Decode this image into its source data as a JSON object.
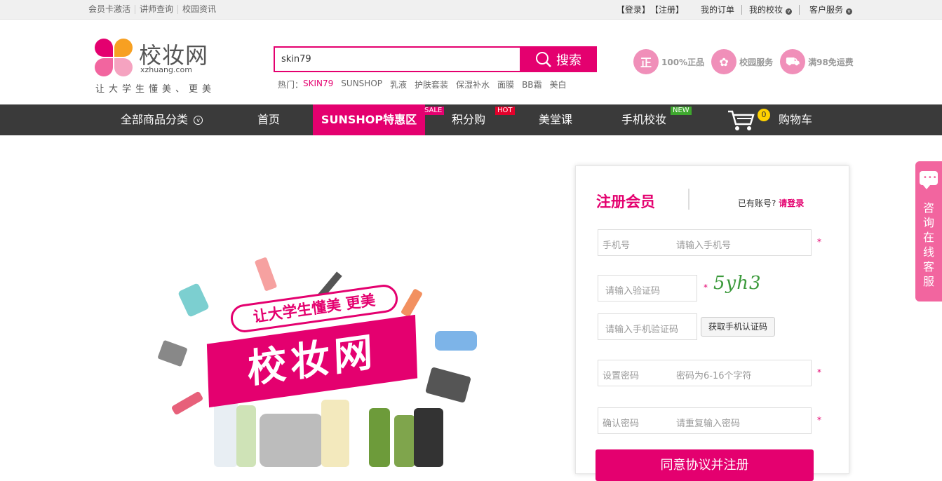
{
  "topbar": {
    "left": [
      "会员卡激活",
      "讲师查询",
      "校园资讯"
    ],
    "login": "【登录】",
    "register": "【注册】",
    "orders": "我的订单",
    "my_campus": "我的校妆",
    "customer_service": "客户服务"
  },
  "logo": {
    "brand": "校妆网",
    "domain": "xzhuang.com",
    "slogan": "让大学生懂美、更美"
  },
  "search": {
    "value": "skin79",
    "button": "搜索",
    "hot_label": "热门：",
    "hot_terms": [
      "SKIN79",
      "SUNSHOP",
      "乳液",
      "护肤套装",
      "保湿补水",
      "面膜",
      "BB霜",
      "美白"
    ]
  },
  "promos": [
    {
      "icon_char": "正",
      "label": "100%正品"
    },
    {
      "icon_char": "✿",
      "label": "校园服务"
    },
    {
      "icon_char": "⛟",
      "label": "满98免运费"
    }
  ],
  "nav": {
    "categories": "全部商品分类",
    "home": "首页",
    "sunshop": "SUNSHOP特惠区",
    "sale": "SALE",
    "points": "积分购",
    "hot": "HOT",
    "beauty_class": "美堂课",
    "mobile": "手机校妆",
    "new": "NEW",
    "cart_count": "0",
    "cart": "购物车"
  },
  "banner": {
    "slogan": "让大学生懂美 更美",
    "main": "校妆网"
  },
  "register": {
    "title": "注册会员",
    "have_account": "已有账号?",
    "login_link": "请登录",
    "phone_label": "手机号",
    "phone_placeholder": "请输入手机号",
    "captcha_placeholder": "请输入验证码",
    "captcha_text": "5yh3",
    "sms_placeholder": "请输入手机验证码",
    "sms_button": "获取手机认证码",
    "password_label": "设置密码",
    "password_placeholder": "密码为6-16个字符",
    "confirm_label": "确认密码",
    "confirm_placeholder": "请重复输入密码",
    "star": "*",
    "submit": "同意协议并注册"
  },
  "service": {
    "text": "咨询在线客服"
  },
  "colors": {
    "accent": "#e4006f",
    "nav_bg": "#3a3a3a",
    "service": "#f2659f"
  }
}
